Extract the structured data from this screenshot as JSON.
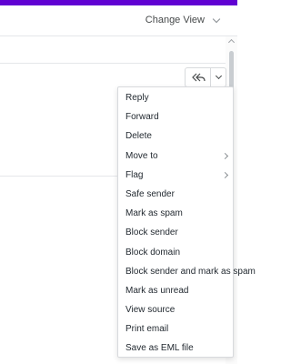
{
  "header": {
    "change_view_label": "Change View"
  },
  "toolbar": {
    "reply_all_icon": "reply-all-icon",
    "more_icon": "chevron-down-icon"
  },
  "menu": {
    "items": [
      {
        "label": "Reply",
        "has_submenu": false
      },
      {
        "label": "Forward",
        "has_submenu": false
      },
      {
        "label": "Delete",
        "has_submenu": false
      },
      {
        "label": "Move to",
        "has_submenu": true
      },
      {
        "label": "Flag",
        "has_submenu": true
      },
      {
        "label": "Safe sender",
        "has_submenu": false
      },
      {
        "label": "Mark as spam",
        "has_submenu": false
      },
      {
        "label": "Block sender",
        "has_submenu": false
      },
      {
        "label": "Block domain",
        "has_submenu": false
      },
      {
        "label": "Block sender and mark as spam",
        "has_submenu": false
      },
      {
        "label": "Mark as unread",
        "has_submenu": false
      },
      {
        "label": "View source",
        "has_submenu": false
      },
      {
        "label": "Print email",
        "has_submenu": false
      },
      {
        "label": "Save as EML file",
        "has_submenu": false
      }
    ]
  },
  "colors": {
    "brand_bar": "#6001d2"
  }
}
